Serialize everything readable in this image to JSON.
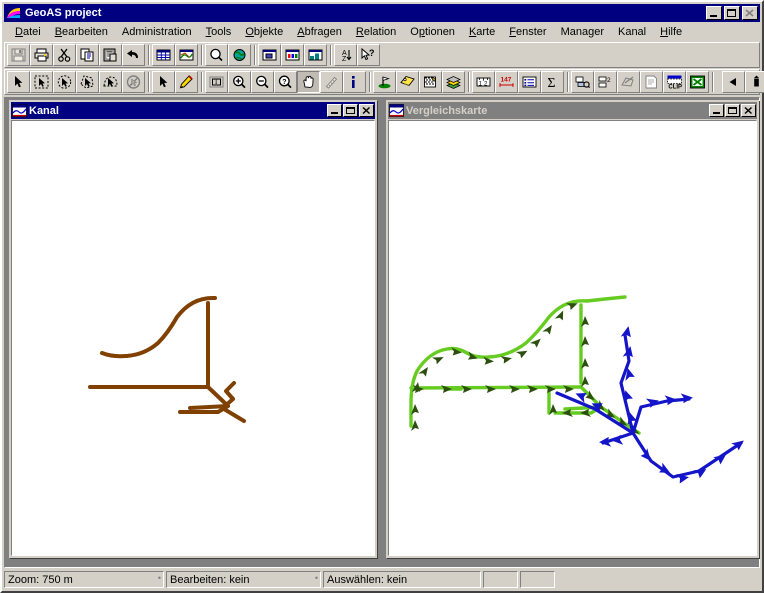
{
  "window": {
    "title": "GeoAS project",
    "icon": "geoas-logo-icon",
    "controls": {
      "minimize": "_",
      "maximize": "□",
      "close": "✕"
    }
  },
  "menubar": {
    "items": [
      {
        "label": "Datei",
        "accel": "D"
      },
      {
        "label": "Bearbeiten",
        "accel": "B"
      },
      {
        "label": "Administration",
        "accel": "A"
      },
      {
        "label": "Tools",
        "accel": "T"
      },
      {
        "label": "Objekte",
        "accel": "O"
      },
      {
        "label": "Abfragen",
        "accel": "A"
      },
      {
        "label": "Relation",
        "accel": "R"
      },
      {
        "label": "Optionen",
        "accel": "p"
      },
      {
        "label": "Karte",
        "accel": "K"
      },
      {
        "label": "Fenster",
        "accel": "F"
      },
      {
        "label": "Manager",
        "accel": ""
      },
      {
        "label": "Kanal",
        "accel": ""
      },
      {
        "label": "Hilfe",
        "accel": "H"
      }
    ]
  },
  "toolbar_main": {
    "buttons": [
      {
        "name": "save-button",
        "icon": "floppy-disk-icon",
        "state": "disabled"
      },
      {
        "name": "print-button",
        "icon": "printer-icon",
        "state": "normal"
      },
      {
        "name": "cut-button",
        "icon": "scissors-icon",
        "state": "normal"
      },
      {
        "name": "copy-button",
        "icon": "copy-pages-icon",
        "state": "normal"
      },
      {
        "name": "paste-button",
        "icon": "clipboard-paste-icon",
        "state": "normal"
      },
      {
        "name": "undo-button",
        "icon": "undo-arrow-icon",
        "state": "normal"
      },
      {
        "name": "new-table-button",
        "icon": "grid-table-icon",
        "state": "normal"
      },
      {
        "name": "new-map-button",
        "icon": "map-window-icon",
        "state": "normal"
      },
      {
        "name": "new-browser-button",
        "icon": "browser-window-icon",
        "state": "normal"
      },
      {
        "name": "find-button",
        "icon": "magnifier-icon",
        "state": "normal"
      },
      {
        "name": "find-selection-button",
        "icon": "globe-icon",
        "state": "normal"
      },
      {
        "name": "new-layout-button",
        "icon": "layout-window-icon",
        "state": "normal"
      },
      {
        "name": "new-legend-button",
        "icon": "legend-window-icon",
        "state": "normal"
      },
      {
        "name": "new-graph-button",
        "icon": "graph-window-icon",
        "state": "normal"
      },
      {
        "name": "sort-button",
        "icon": "sort-az-icon",
        "state": "normal"
      },
      {
        "name": "help-pointer-button",
        "icon": "pointer-question-icon",
        "state": "normal"
      }
    ]
  },
  "toolbar_tools": {
    "buttons": [
      {
        "name": "select-button",
        "icon": "arrow-pointer-icon",
        "state": "normal"
      },
      {
        "name": "marquee-select-button",
        "icon": "marquee-select-icon",
        "state": "normal"
      },
      {
        "name": "radius-select-button",
        "icon": "radius-select-icon",
        "state": "normal"
      },
      {
        "name": "polygon-select-button",
        "icon": "polygon-select-icon",
        "state": "normal"
      },
      {
        "name": "boundary-select-button",
        "icon": "boundary-select-icon",
        "state": "normal"
      },
      {
        "name": "unselect-all-button",
        "icon": "unselect-all-icon",
        "state": "normal"
      },
      {
        "name": "pick-button",
        "icon": "pick-arrow-icon",
        "state": "normal"
      },
      {
        "name": "draw-pencil-button",
        "icon": "pencil-icon",
        "state": "normal"
      },
      {
        "name": "text-button",
        "icon": "text-box-icon",
        "state": "normal"
      },
      {
        "name": "zoom-in-button",
        "icon": "zoom-in-icon",
        "state": "normal"
      },
      {
        "name": "zoom-out-button",
        "icon": "zoom-out-icon",
        "state": "normal"
      },
      {
        "name": "zoom-query-button",
        "icon": "zoom-question-icon",
        "state": "normal"
      },
      {
        "name": "pan-button",
        "icon": "hand-pan-icon",
        "state": "pressed"
      },
      {
        "name": "ruler-button",
        "icon": "ruler-line-icon",
        "state": "normal"
      },
      {
        "name": "info-button",
        "icon": "info-i-icon",
        "state": "normal"
      },
      {
        "name": "hotlink-button",
        "icon": "golf-flag-icon",
        "state": "normal"
      },
      {
        "name": "label-button",
        "icon": "label-tag-icon",
        "state": "normal"
      },
      {
        "name": "thematic-button",
        "icon": "thematic-map-icon",
        "state": "normal"
      },
      {
        "name": "layer-control-button",
        "icon": "layers-stack-icon",
        "state": "normal"
      },
      {
        "name": "coordinate-button",
        "icon": "numbers-12-icon",
        "state": "normal"
      },
      {
        "name": "measure-button",
        "icon": "measure-147-icon",
        "state": "normal"
      },
      {
        "name": "browse-table-button",
        "icon": "list-table-icon",
        "state": "normal"
      },
      {
        "name": "sum-button",
        "icon": "sigma-sum-icon",
        "state": "normal"
      },
      {
        "name": "network-button",
        "icon": "network-node-icon",
        "state": "normal"
      },
      {
        "name": "profile-button",
        "icon": "profile-blocks-icon",
        "state": "normal"
      },
      {
        "name": "sketch-button",
        "icon": "sketch-pen-icon",
        "state": "normal"
      },
      {
        "name": "report-button",
        "icon": "report-page-icon",
        "state": "normal"
      },
      {
        "name": "clip-button",
        "icon": "clip-region-icon",
        "state": "normal"
      },
      {
        "name": "excel-export-button",
        "icon": "excel-sheet-icon",
        "state": "normal"
      },
      {
        "name": "previous-button",
        "icon": "left-triangle-icon",
        "state": "normal"
      },
      {
        "name": "tower-button",
        "icon": "tower-icon",
        "state": "normal"
      }
    ]
  },
  "mdi_windows": [
    {
      "name": "kanal",
      "title": "Kanal",
      "active": true,
      "icon": "map-window-icon",
      "controls": {
        "minimize": "_",
        "maximize": "□",
        "close": "✕"
      }
    },
    {
      "name": "vergleichskarte",
      "title": "Vergleichskarte",
      "active": false,
      "icon": "map-window-icon",
      "controls": {
        "minimize": "_",
        "maximize": "□",
        "close": "✕"
      }
    }
  ],
  "statusbar": {
    "zoom": "Zoom: 750 m",
    "edit": "Bearbeiten: kein",
    "select": "Auswählen: kein",
    "panel4": "",
    "panel5": ""
  },
  "map_colors": {
    "brown": "#804000",
    "red": "#ff0000",
    "yellow": "#ffff00",
    "magenta": "#ff00ff",
    "blue": "#1414c8",
    "green": "#66cc22",
    "dark_green": "#2d4f10",
    "canvas": "#ffffff"
  }
}
